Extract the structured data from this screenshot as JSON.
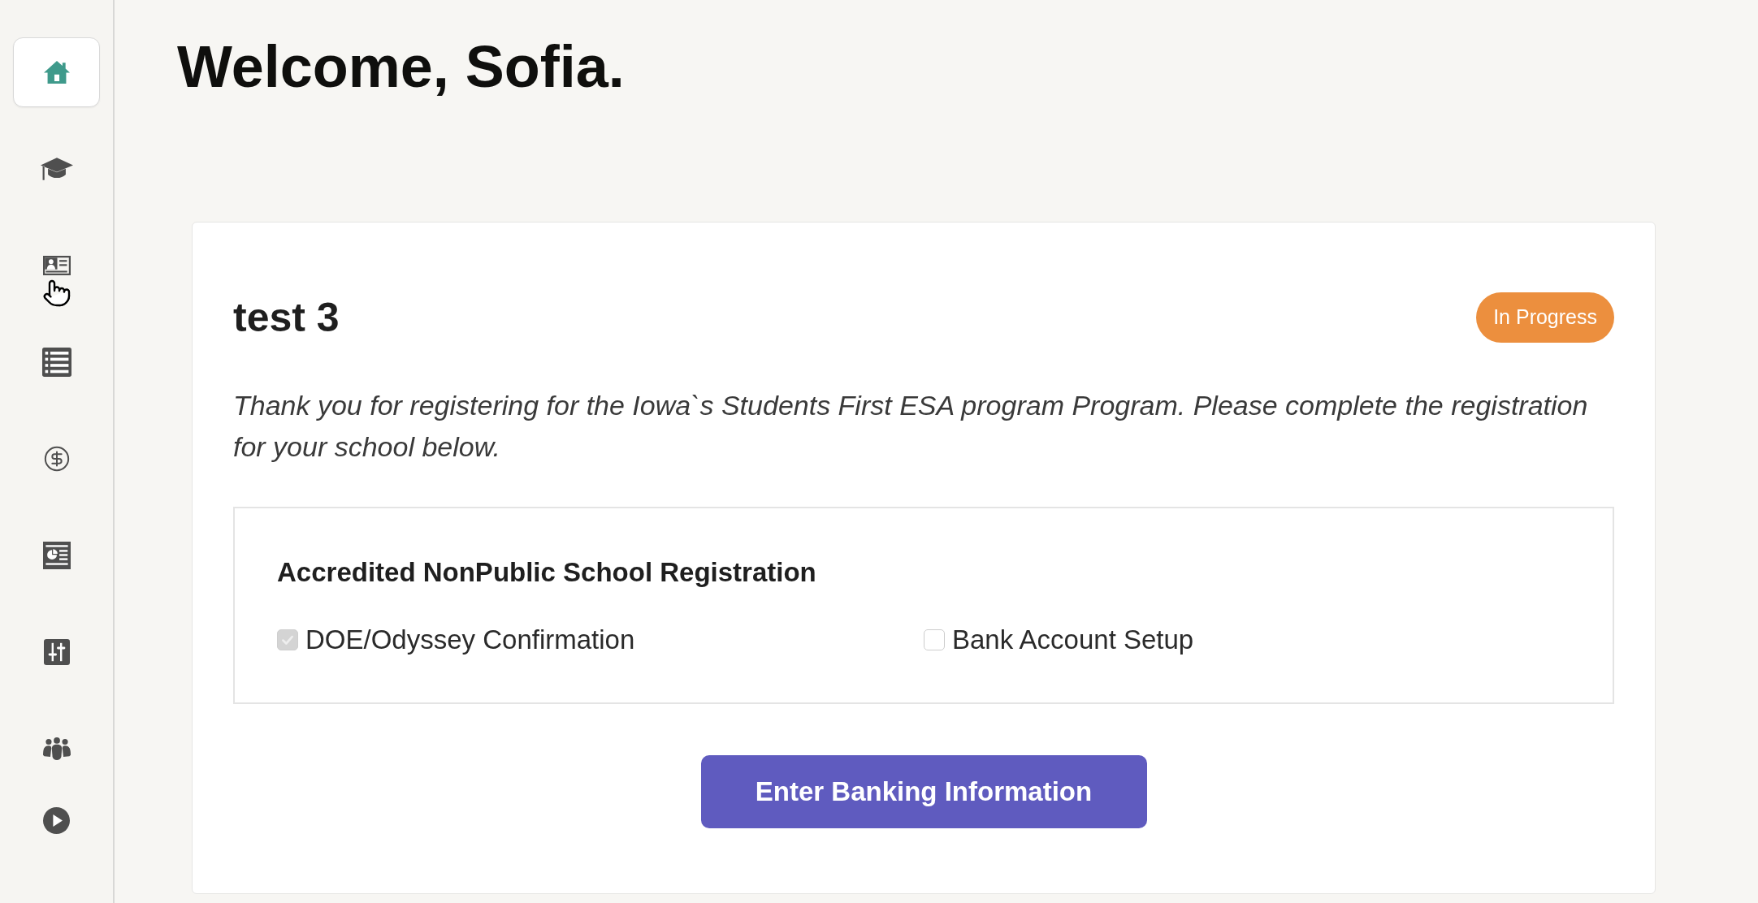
{
  "sidebar": {
    "items": [
      {
        "selected": true
      },
      {
        "selected": false
      },
      {
        "selected": false
      },
      {
        "selected": false
      },
      {
        "selected": false
      },
      {
        "selected": false
      },
      {
        "selected": false
      },
      {
        "selected": false
      },
      {
        "selected": false
      }
    ]
  },
  "heading": "Welcome, Sofia.",
  "card": {
    "title": "test 3",
    "status": "In Progress",
    "description": "Thank you for registering for the Iowa`s Students First ESA program Program. Please complete the registration for your school below.",
    "section": {
      "title": "Accredited NonPublic School Registration",
      "tasks": [
        {
          "label": "DOE/Odyssey Confirmation",
          "checked": true
        },
        {
          "label": "Bank Account Setup",
          "checked": false
        }
      ]
    },
    "action": "Enter Banking Information"
  }
}
